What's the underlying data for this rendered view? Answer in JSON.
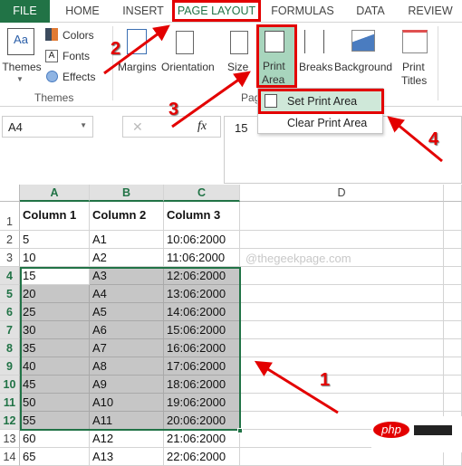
{
  "tabs": {
    "file": "FILE",
    "home": "HOME",
    "insert": "INSERT",
    "page_layout": "PAGE LAYOUT",
    "formulas": "FORMULAS",
    "data": "DATA",
    "review": "REVIEW"
  },
  "ribbon": {
    "themes": "Themes",
    "colors": "Colors",
    "fonts": "Fonts",
    "effects": "Effects",
    "themes_group": "Themes",
    "margins": "Margins",
    "orientation": "Orientation",
    "size": "Size",
    "print_area_1": "Print",
    "print_area_2": "Area",
    "breaks": "Breaks",
    "background": "Background",
    "print_titles_1": "Print",
    "print_titles_2": "Titles",
    "page_setup_group": "Pag"
  },
  "dropdown": {
    "set_print_area": "Set Print Area",
    "clear_print_area": "Clear Print Area"
  },
  "formula_bar": {
    "name_box": "A4",
    "fx": "fx",
    "value": "15"
  },
  "columns": [
    "A",
    "B",
    "C",
    "D"
  ],
  "rows": [
    {
      "n": "1",
      "a": "Column 1",
      "b": "Column 2",
      "c": "Column 3"
    },
    {
      "n": "2",
      "a": "5",
      "b": "A1",
      "c": "10:06:2000"
    },
    {
      "n": "3",
      "a": "10",
      "b": "A2",
      "c": "11:06:2000"
    },
    {
      "n": "4",
      "a": "15",
      "b": "A3",
      "c": "12:06:2000"
    },
    {
      "n": "5",
      "a": "20",
      "b": "A4",
      "c": "13:06:2000"
    },
    {
      "n": "6",
      "a": "25",
      "b": "A5",
      "c": "14:06:2000"
    },
    {
      "n": "7",
      "a": "30",
      "b": "A6",
      "c": "15:06:2000"
    },
    {
      "n": "8",
      "a": "35",
      "b": "A7",
      "c": "16:06:2000"
    },
    {
      "n": "9",
      "a": "40",
      "b": "A8",
      "c": "17:06:2000"
    },
    {
      "n": "10",
      "a": "45",
      "b": "A9",
      "c": "18:06:2000"
    },
    {
      "n": "11",
      "a": "50",
      "b": "A10",
      "c": "19:06:2000"
    },
    {
      "n": "12",
      "a": "55",
      "b": "A11",
      "c": "20:06:2000"
    },
    {
      "n": "13",
      "a": "60",
      "b": "A12",
      "c": "21:06:2000"
    },
    {
      "n": "14",
      "a": "65",
      "b": "A13",
      "c": "22:06:2000"
    }
  ],
  "watermark": "@thegeekpage.com",
  "annotations": [
    "1",
    "2",
    "3",
    "4"
  ],
  "logo": "php",
  "colors": {
    "excel_green": "#217346",
    "annotation_red": "#e30000",
    "selection_gray": "#c6c6c6",
    "highlight": "#cfe8d9"
  }
}
